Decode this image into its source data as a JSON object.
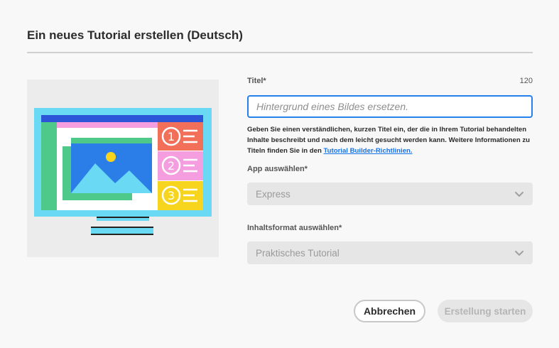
{
  "dialog": {
    "title": "Ein neues Tutorial erstellen (Deutsch)"
  },
  "illustration": {
    "icon": "monitor-tutorial-illustration",
    "step_numbers": [
      "1",
      "2",
      "3"
    ],
    "colors": {
      "monitor_frame": "#6ad9f3",
      "topbar": "#2b55d6",
      "sidebar": "#4ec98a",
      "image_bg": "#2b7ee8",
      "step1": "#f26f5a",
      "step2": "#f49ee0",
      "step3": "#f7d51e"
    }
  },
  "form": {
    "title_field": {
      "label": "Titel*",
      "char_count": "120",
      "placeholder": "Hintergrund eines Bildes ersetzen.",
      "value": ""
    },
    "help_text": "Geben Sie einen verständlichen, kurzen Titel ein, der die in Ihrem Tutorial behandelten Inhalte beschreibt und nach dem leicht gesucht werden kann. Weitere Informationen zu Titeln finden Sie in den ",
    "help_link": "Tutorial Builder-Richtlinien.",
    "app_select": {
      "label": "App auswählen*",
      "selected": "Express",
      "icon": "chevron-down-icon"
    },
    "format_select": {
      "label": "Inhaltsformat auswählen*",
      "selected": "Praktisches Tutorial",
      "icon": "chevron-down-icon"
    }
  },
  "buttons": {
    "cancel": "Abbrechen",
    "start": "Erstellung starten"
  },
  "colors": {
    "accent": "#2680eb",
    "link": "#1473e6",
    "disabled_bg": "#e6e6e6"
  }
}
